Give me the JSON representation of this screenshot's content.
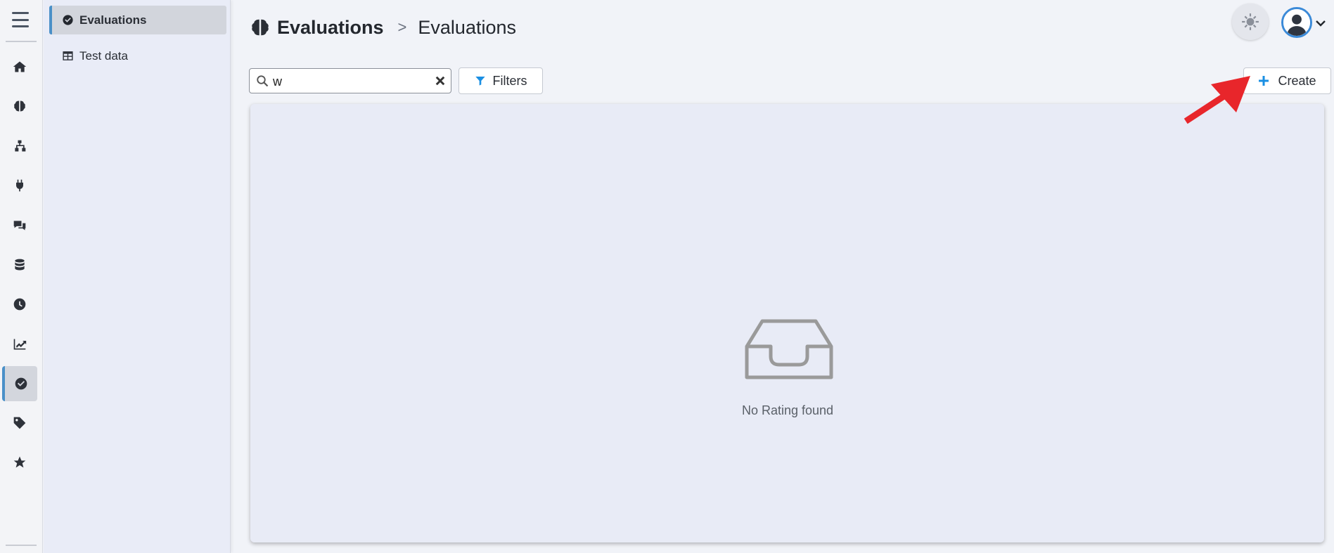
{
  "rail": {
    "icons": [
      "menu-icon",
      "home-icon",
      "brain-icon",
      "sitemap-icon",
      "plug-icon",
      "chat-icon",
      "database-icon",
      "clock-icon",
      "chart-icon",
      "check-circle-icon",
      "tag-icon",
      "star-icon"
    ],
    "active": "check-circle-icon"
  },
  "subnav": {
    "items": [
      {
        "label": "Evaluations",
        "icon": "check-circle-icon",
        "active": true
      },
      {
        "label": "Test data",
        "icon": "table-icon",
        "active": false
      }
    ]
  },
  "header": {
    "breadcrumb_root": "Evaluations",
    "breadcrumb_separator": ">",
    "breadcrumb_current": "Evaluations"
  },
  "toolbar": {
    "search_value": "w",
    "filters_label": "Filters",
    "create_label": "Create"
  },
  "empty_state": {
    "message": "No Rating found"
  },
  "colors": {
    "accent": "#4a90c8",
    "create_plus": "#1a8fe3",
    "annotation_arrow": "#e8262b"
  }
}
